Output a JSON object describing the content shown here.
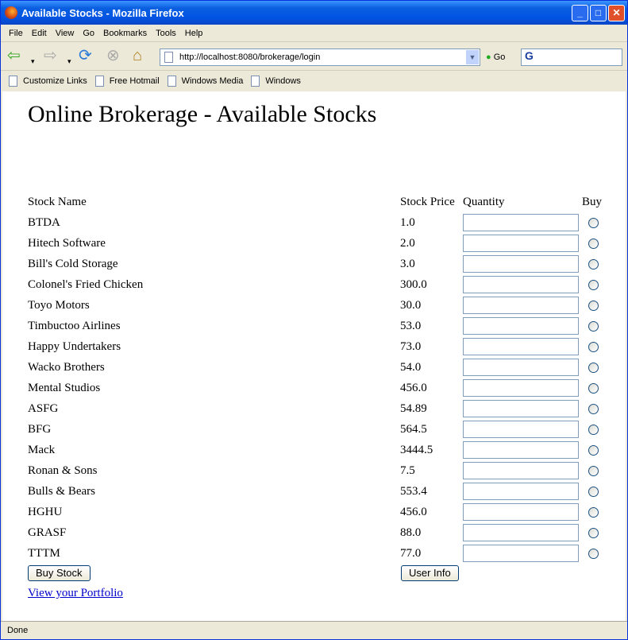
{
  "window": {
    "title": "Available Stocks - Mozilla Firefox"
  },
  "menu": [
    "File",
    "Edit",
    "View",
    "Go",
    "Bookmarks",
    "Tools",
    "Help"
  ],
  "nav": {
    "url": "http://localhost:8080/brokerage/login",
    "go_label": "Go",
    "search_logo": "G"
  },
  "bookmarks": [
    "Customize Links",
    "Free Hotmail",
    "Windows Media",
    "Windows"
  ],
  "page": {
    "title": "Online Brokerage - Available Stocks",
    "headers": {
      "name": "Stock Name",
      "price": "Stock Price",
      "quantity": "Quantity",
      "buy": "Buy"
    },
    "stocks": [
      {
        "name": "BTDA",
        "price": "1.0"
      },
      {
        "name": "Hitech Software",
        "price": "2.0"
      },
      {
        "name": "Bill's Cold Storage",
        "price": "3.0"
      },
      {
        "name": "Colonel's Fried Chicken",
        "price": "300.0"
      },
      {
        "name": "Toyo Motors",
        "price": "30.0"
      },
      {
        "name": "Timbuctoo Airlines",
        "price": "53.0"
      },
      {
        "name": "Happy Undertakers",
        "price": "73.0"
      },
      {
        "name": "Wacko Brothers",
        "price": "54.0"
      },
      {
        "name": "Mental Studios",
        "price": "456.0"
      },
      {
        "name": "ASFG",
        "price": "54.89"
      },
      {
        "name": "BFG",
        "price": "564.5"
      },
      {
        "name": "Mack",
        "price": "3444.5"
      },
      {
        "name": "Ronan & Sons",
        "price": "7.5"
      },
      {
        "name": "Bulls & Bears",
        "price": "553.4"
      },
      {
        "name": "HGHU",
        "price": "456.0"
      },
      {
        "name": "GRASF",
        "price": "88.0"
      },
      {
        "name": "TTTM",
        "price": "77.0"
      }
    ],
    "buy_button": "Buy Stock",
    "user_info_button": "User Info",
    "portfolio_link": "View your Portfolio"
  },
  "status": "Done"
}
